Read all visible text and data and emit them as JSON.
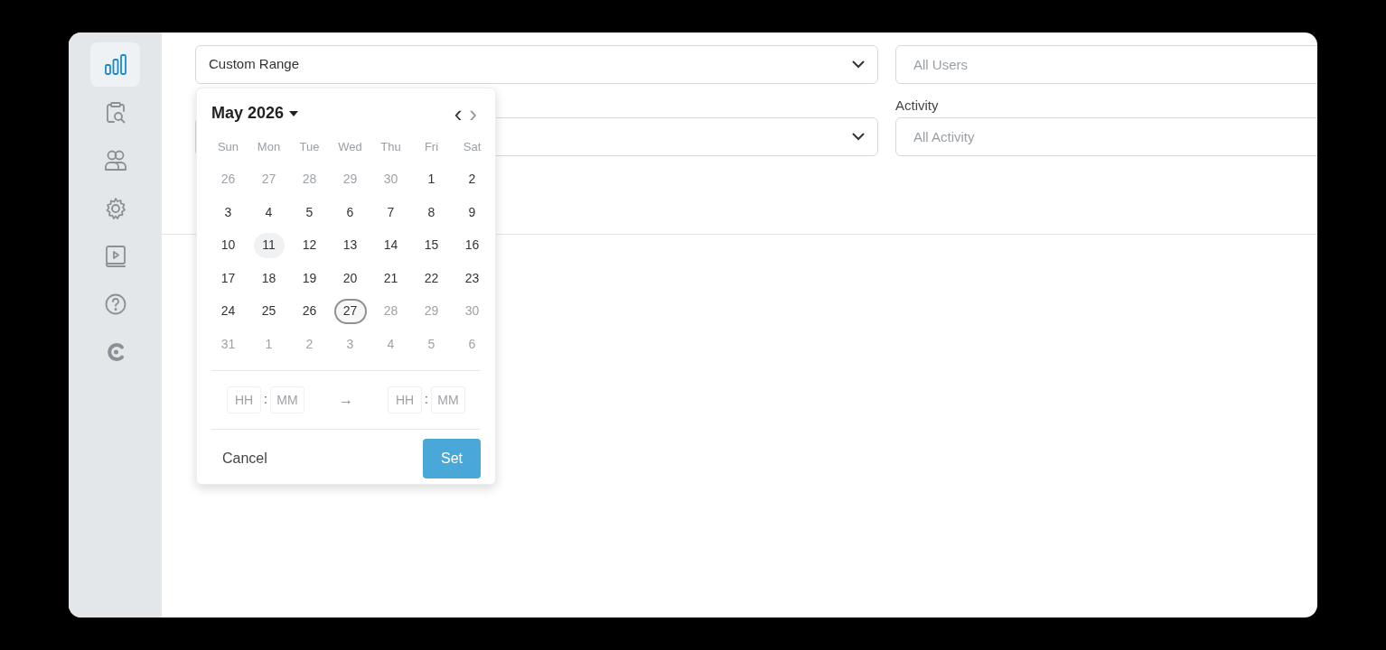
{
  "sidebar": {
    "items": [
      {
        "selected": true
      },
      {
        "selected": false
      },
      {
        "selected": false
      },
      {
        "selected": false
      },
      {
        "selected": false
      },
      {
        "selected": false
      },
      {
        "selected": false
      }
    ]
  },
  "filters": [
    {
      "kind": "select",
      "value": "Custom Range"
    },
    {
      "kind": "input",
      "placeholder": "All Users"
    },
    {
      "kind": "select"
    },
    {
      "kind": "input",
      "label": "Activity",
      "placeholder": "All Activity"
    }
  ],
  "calendar": {
    "month": "May 2026",
    "prev": "‹",
    "next": "›",
    "weekdays": [
      "Sun",
      "Mon",
      "Tue",
      "Wed",
      "Thu",
      "Fri",
      "Sat"
    ],
    "days": [
      {
        "label": "26",
        "muted": true,
        "selected": false,
        "hovered": false
      },
      {
        "label": "27",
        "muted": true,
        "selected": false,
        "hovered": false
      },
      {
        "label": "28",
        "muted": true,
        "selected": false,
        "hovered": false
      },
      {
        "label": "29",
        "muted": true,
        "selected": false,
        "hovered": false
      },
      {
        "label": "30",
        "muted": true,
        "selected": false,
        "hovered": false
      },
      {
        "label": "1",
        "muted": false,
        "selected": false,
        "hovered": false
      },
      {
        "label": "2",
        "muted": false,
        "selected": false,
        "hovered": false
      },
      {
        "label": "3",
        "muted": false,
        "selected": false,
        "hovered": false
      },
      {
        "label": "4",
        "muted": false,
        "selected": false,
        "hovered": false
      },
      {
        "label": "5",
        "muted": false,
        "selected": false,
        "hovered": false
      },
      {
        "label": "6",
        "muted": false,
        "selected": false,
        "hovered": false
      },
      {
        "label": "7",
        "muted": false,
        "selected": false,
        "hovered": false
      },
      {
        "label": "8",
        "muted": false,
        "selected": false,
        "hovered": false
      },
      {
        "label": "9",
        "muted": false,
        "selected": false,
        "hovered": false
      },
      {
        "label": "10",
        "muted": false,
        "selected": false,
        "hovered": false
      },
      {
        "label": "11",
        "muted": false,
        "selected": false,
        "hovered": true
      },
      {
        "label": "12",
        "muted": false,
        "selected": false,
        "hovered": false
      },
      {
        "label": "13",
        "muted": false,
        "selected": false,
        "hovered": false
      },
      {
        "label": "14",
        "muted": false,
        "selected": false,
        "hovered": false
      },
      {
        "label": "15",
        "muted": false,
        "selected": false,
        "hovered": false
      },
      {
        "label": "16",
        "muted": false,
        "selected": false,
        "hovered": false
      },
      {
        "label": "17",
        "muted": false,
        "selected": false,
        "hovered": false
      },
      {
        "label": "18",
        "muted": false,
        "selected": false,
        "hovered": false
      },
      {
        "label": "19",
        "muted": false,
        "selected": false,
        "hovered": false
      },
      {
        "label": "20",
        "muted": false,
        "selected": false,
        "hovered": false
      },
      {
        "label": "21",
        "muted": false,
        "selected": false,
        "hovered": false
      },
      {
        "label": "22",
        "muted": false,
        "selected": false,
        "hovered": false
      },
      {
        "label": "23",
        "muted": false,
        "selected": false,
        "hovered": false
      },
      {
        "label": "24",
        "muted": false,
        "selected": false,
        "hovered": false
      },
      {
        "label": "25",
        "muted": false,
        "selected": false,
        "hovered": false
      },
      {
        "label": "26",
        "muted": false,
        "selected": false,
        "hovered": false
      },
      {
        "label": "27",
        "muted": false,
        "selected": true,
        "hovered": false
      },
      {
        "label": "28",
        "muted": true,
        "selected": false,
        "hovered": false
      },
      {
        "label": "29",
        "muted": true,
        "selected": false,
        "hovered": false
      },
      {
        "label": "30",
        "muted": true,
        "selected": false,
        "hovered": false
      },
      {
        "label": "31",
        "muted": true,
        "selected": false,
        "hovered": false
      },
      {
        "label": "1",
        "muted": true,
        "selected": false,
        "hovered": false
      },
      {
        "label": "2",
        "muted": true,
        "selected": false,
        "hovered": false
      },
      {
        "label": "3",
        "muted": true,
        "selected": false,
        "hovered": false
      },
      {
        "label": "4",
        "muted": true,
        "selected": false,
        "hovered": false
      },
      {
        "label": "5",
        "muted": true,
        "selected": false,
        "hovered": false
      },
      {
        "label": "6",
        "muted": true,
        "selected": false,
        "hovered": false
      }
    ],
    "time": {
      "start": {
        "hours_placeholder": "HH",
        "separator": ":",
        "minutes_placeholder": "MM"
      },
      "arrow": "→",
      "end": {
        "hours_placeholder": "HH",
        "separator": ":",
        "minutes_placeholder": "MM"
      }
    },
    "cancel": "Cancel",
    "set": "Set"
  }
}
